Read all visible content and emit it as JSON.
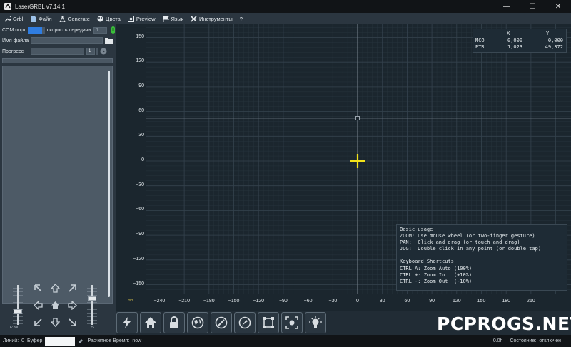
{
  "window": {
    "title": "LaserGRBL v7.14.1",
    "minimize": "—",
    "maximize": "☐",
    "close": "✕"
  },
  "menu": [
    {
      "label": "Grbl",
      "icon": "wrench-icon"
    },
    {
      "label": "Файл",
      "icon": "file-icon"
    },
    {
      "label": "Generate",
      "icon": "flask-icon"
    },
    {
      "label": "Цвета",
      "icon": "palette-icon"
    },
    {
      "label": "Preview",
      "icon": "preview-icon"
    },
    {
      "label": "Язык",
      "icon": "flag-icon"
    },
    {
      "label": "Инструменты",
      "icon": "tools-icon"
    },
    {
      "label": "?",
      "icon": ""
    }
  ],
  "connection": {
    "com_label": "COM порт",
    "speed_label": "скорость передачи",
    "speed_value": "1"
  },
  "file": {
    "label": "Имя файла",
    "value": ""
  },
  "progress": {
    "label": "Прогресс",
    "count": "1"
  },
  "jog": {
    "speed_label": "F:280",
    "step_label": "5"
  },
  "canvas": {
    "y_ticks": [
      "150",
      "120",
      "90",
      "60",
      "30",
      "0",
      "−30",
      "−60",
      "−90",
      "−120",
      "−150"
    ],
    "x_ticks": [
      "−240",
      "−210",
      "−180",
      "−150",
      "−120",
      "−90",
      "−60",
      "−30",
      "0",
      "30",
      "60",
      "90",
      "120",
      "150",
      "180",
      "210"
    ],
    "unit": "mm",
    "coords": {
      "x_header": "X",
      "y_header": "Y",
      "rows": [
        {
          "name": "MCO",
          "x": "0,000",
          "y": "0,000"
        },
        {
          "name": "PTR",
          "x": "1,023",
          "y": "49,372"
        }
      ]
    },
    "help": "Basic usage\nZOOM: Use mouse wheel (or two-finger gesture)\nPAN:  Click and drag (or touch and drag)\nJOG:  Double click in any point (or double tap)\n\nKeyboard Shortcuts\nCTRL A: Zoom Auto (100%)\nCTRL +: Zoom In   (+10%)\nCTRL -: Zoom Out  (-10%)"
  },
  "toolbar": [
    {
      "name": "lightning-icon"
    },
    {
      "name": "home-icon"
    },
    {
      "name": "lock-icon"
    },
    {
      "name": "globe-icon"
    },
    {
      "name": "compass-icon"
    },
    {
      "name": "compass-pen-icon"
    },
    {
      "name": "frame-icon"
    },
    {
      "name": "focus-icon"
    },
    {
      "name": "bulb-icon"
    }
  ],
  "watermark": "PCPROGS.NET",
  "status": {
    "lines_label": "Линий:",
    "lines_value": "0",
    "buffer_label": "Буфер",
    "time_label": "Расчетное Время:",
    "time_value": "now",
    "hours": "0.0h",
    "state_label": "Состояние:",
    "state_value": "отключен"
  },
  "colors": {
    "accent": "#2f7de1",
    "cursor": "#f2e21a",
    "connected_icon": "#3bbf3b"
  }
}
